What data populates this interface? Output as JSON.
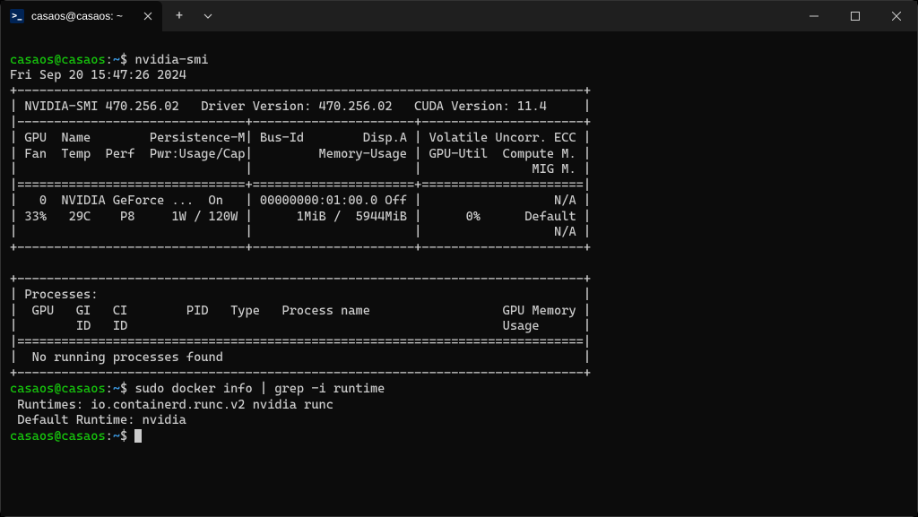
{
  "titlebar": {
    "tab_icon_glyph": ">_",
    "tab_title": "casaos@casaos: ~",
    "new_tab_glyph": "+",
    "dropdown_glyph": "⌄"
  },
  "prompt": {
    "user_host": "casaos@casaos",
    "colon": ":",
    "path": "~",
    "dollar": "$ "
  },
  "cmd1": "nvidia-smi",
  "smi_date": "Fri Sep 20 15:47:26 2024",
  "smi_top": "+-----------------------------------------------------------------------------+",
  "smi_head1": "| NVIDIA-SMI 470.256.02   Driver Version: 470.256.02   CUDA Version: 11.4     |",
  "smi_sep1": "|-------------------------------+----------------------+----------------------+",
  "smi_col1": "| GPU  Name        Persistence-M| Bus-Id        Disp.A | Volatile Uncorr. ECC |",
  "smi_col2": "| Fan  Temp  Perf  Pwr:Usage/Cap|         Memory-Usage | GPU-Util  Compute M. |",
  "smi_col3": "|                               |                      |               MIG M. |",
  "smi_sep2": "|===============================+======================+======================|",
  "smi_row1": "|   0  NVIDIA GeForce ...  On   | 00000000:01:00.0 Off |                  N/A |",
  "smi_row2": "| 33%   29C    P8     1W / 120W |      1MiB /  5944MiB |      0%      Default |",
  "smi_row3": "|                               |                      |                  N/A |",
  "smi_sep3": "+-------------------------------+----------------------+----------------------+",
  "smi_blank": "                                                                               ",
  "smi_ptop": "+-----------------------------------------------------------------------------+",
  "smi_p1": "| Processes:                                                                  |",
  "smi_p2": "|  GPU   GI   CI        PID   Type   Process name                  GPU Memory |",
  "smi_p3": "|        ID   ID                                                   Usage      |",
  "smi_psep": "|=============================================================================|",
  "smi_p4": "|  No running processes found                                                 |",
  "smi_pbot": "+-----------------------------------------------------------------------------+",
  "cmd2": "sudo docker info | grep -i runtime",
  "out1": " Runtimes: io.containerd.runc.v2 nvidia runc",
  "out2": " Default Runtime: nvidia"
}
